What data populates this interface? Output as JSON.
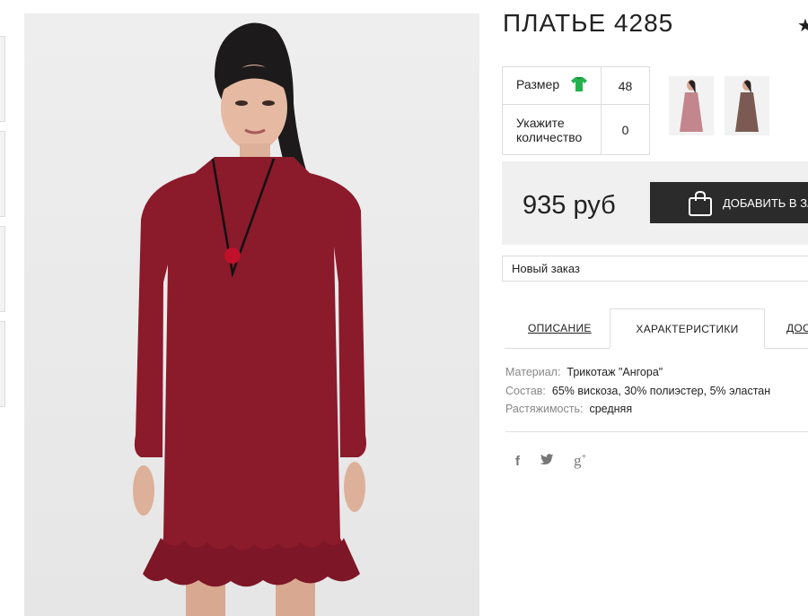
{
  "product": {
    "title": "ПЛАТЬЕ 4285"
  },
  "icons": {
    "favorite": "star-icon",
    "size_chart": "tshirt-icon",
    "cart": "shopping-bag-icon",
    "social": [
      "facebook-icon",
      "twitter-icon",
      "google-plus-icon"
    ]
  },
  "options": {
    "size_label": "Размер",
    "size_value": "48",
    "quantity_label": "Укажите количество",
    "quantity_value": "0"
  },
  "price": {
    "amount": "935 руб"
  },
  "cart_button": {
    "label": "ДОБАВИТЬ В ЗАКАЗ"
  },
  "order_select": {
    "value": "Новый заказ"
  },
  "tabs": [
    {
      "label": "ОПИСАНИЕ",
      "active": false
    },
    {
      "label": "ХАРАКТЕРИСТИКИ",
      "active": true
    },
    {
      "label": "ДОСТАВКА",
      "active": false
    }
  ],
  "specs": [
    {
      "key": "Материал:",
      "value": "Трикотаж \"Ангора\""
    },
    {
      "key": "Состав:",
      "value": "65% вискоза, 30% полиэстер, 5% эластан"
    },
    {
      "key": "Растяжимость:",
      "value": "средняя"
    }
  ],
  "colors": {
    "accent_dark": "#2b2b2b",
    "dress": "#8b1a2b",
    "size_icon": "#22b14c"
  }
}
